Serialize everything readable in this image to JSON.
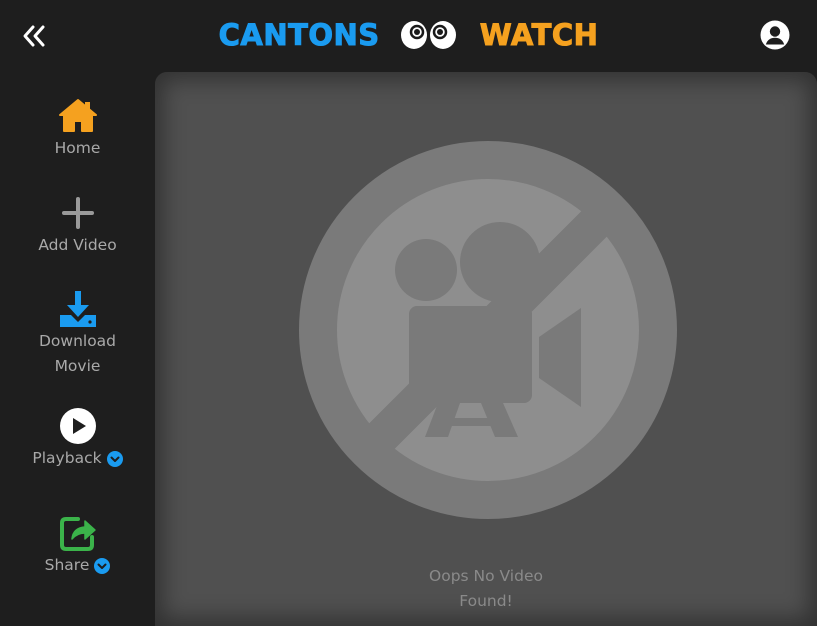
{
  "header": {
    "brand_left": "CANTONS",
    "brand_right": "WATCH",
    "back_icon": "double-chevron-left-icon",
    "profile_icon": "user-circle-icon"
  },
  "sidebar": {
    "items": [
      {
        "label": "Home",
        "icon": "home-icon",
        "color": "#f5a11f"
      },
      {
        "label": "Add Video",
        "icon": "plus-icon",
        "color": "#9a9a9a"
      },
      {
        "label_line1": "Download",
        "label_line2": "Movie",
        "icon": "download-icon",
        "color": "#1a9bf0"
      },
      {
        "label": "Playback",
        "icon": "play-circle-icon",
        "color": "#ffffff",
        "has_dropdown": true
      },
      {
        "label": "Share",
        "icon": "share-icon",
        "color": "#3bb34a",
        "has_dropdown": true
      }
    ]
  },
  "main": {
    "empty_line1": "Oops No Video",
    "empty_line2": "Found!",
    "empty_icon": "no-video-camera-icon"
  },
  "colors": {
    "brand_blue": "#1a9bf0",
    "brand_orange": "#f5a11f",
    "share_green": "#3bb34a",
    "background": "#1e1e1e",
    "panel": "#505050"
  }
}
